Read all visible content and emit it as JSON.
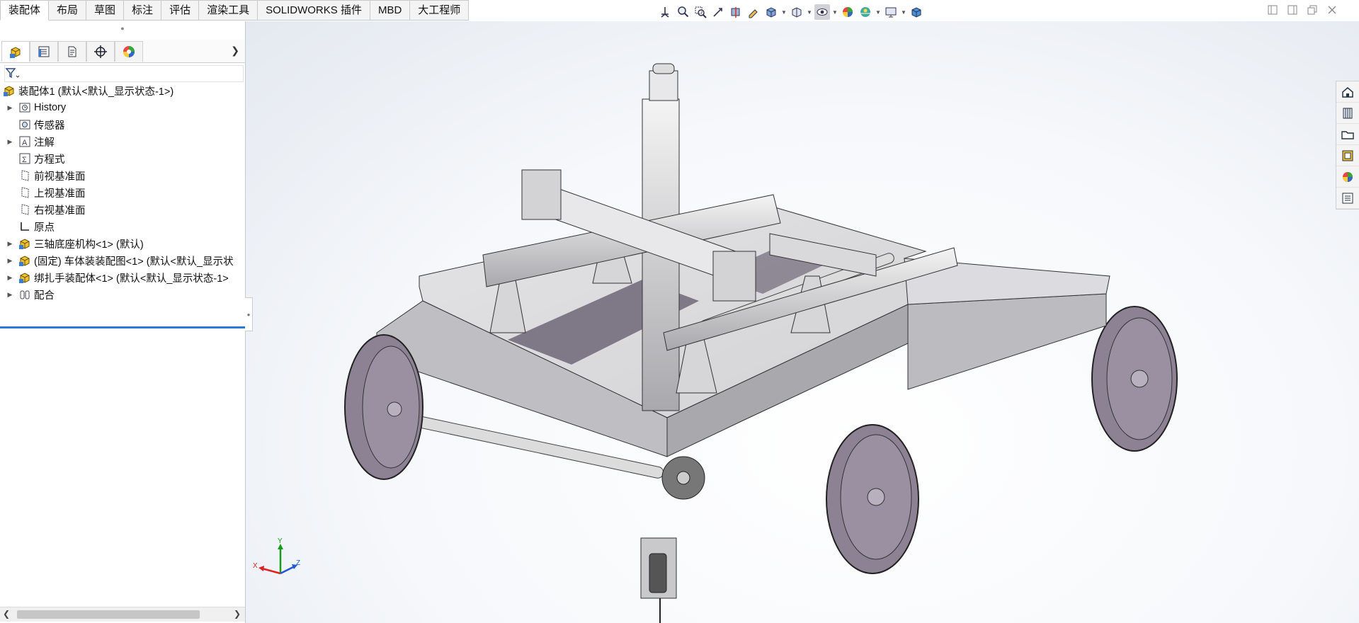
{
  "ribbon": {
    "tabs": [
      {
        "label": "装配体",
        "active": true
      },
      {
        "label": "布局"
      },
      {
        "label": "草图"
      },
      {
        "label": "标注"
      },
      {
        "label": "评估"
      },
      {
        "label": "渲染工具"
      },
      {
        "label": "SOLIDWORKS 插件"
      },
      {
        "label": "MBD"
      },
      {
        "label": "大工程师"
      }
    ]
  },
  "view_toolbar": {
    "icons": [
      "view-orientation-icon",
      "zoom-to-fit-icon",
      "zoom-to-area-icon",
      "previous-view-icon",
      "section-view-icon",
      "dynamic-annotation-icon",
      "view-orientation-cube-icon",
      "display-style-icon",
      "hide-show-items-icon",
      "edit-appearance-icon",
      "apply-scene-icon",
      "view-settings-icon",
      "3d-view-icon"
    ]
  },
  "feature_tree": {
    "panel_tabs": [
      "featuremanager-icon",
      "propertymanager-icon",
      "configurationmanager-icon",
      "dimxpert-icon",
      "displaymanager-icon"
    ],
    "nodes": [
      {
        "label": "装配体1  (默认<默认_显示状态-1>)",
        "icon": "assembly-icon",
        "expandable": false,
        "root": true
      },
      {
        "label": "History",
        "icon": "history-icon",
        "expandable": true
      },
      {
        "label": "传感器",
        "icon": "sensor-icon",
        "expandable": false
      },
      {
        "label": "注解",
        "icon": "annotation-icon",
        "expandable": true
      },
      {
        "label": "方程式",
        "icon": "equation-icon",
        "expandable": false
      },
      {
        "label": "前视基准面",
        "icon": "plane-icon",
        "expandable": false
      },
      {
        "label": "上视基准面",
        "icon": "plane-icon",
        "expandable": false
      },
      {
        "label": "右视基准面",
        "icon": "plane-icon",
        "expandable": false
      },
      {
        "label": "原点",
        "icon": "origin-icon",
        "expandable": false
      },
      {
        "label": "三轴底座机构<1> (默认)",
        "icon": "subassembly-icon",
        "expandable": true
      },
      {
        "label": "(固定) 车体装装配图<1> (默认<默认_显示状",
        "icon": "subassembly-icon",
        "expandable": true
      },
      {
        "label": "绑扎手装配体<1> (默认<默认_显示状态-1>",
        "icon": "subassembly-icon",
        "expandable": true
      },
      {
        "label": "配合",
        "icon": "mates-icon",
        "expandable": true
      }
    ]
  },
  "task_pane": {
    "icons": [
      "solidworks-resources-icon",
      "design-library-icon",
      "file-explorer-icon",
      "view-palette-icon",
      "appearances-icon",
      "custom-properties-icon"
    ]
  },
  "triad": {
    "x_label": "X",
    "y_label": "Y",
    "z_label": "Z"
  },
  "colors": {
    "model_face": "#c9c9cb",
    "model_shadow": "#6f6677",
    "wheel": "#8c8294",
    "accent": "#2a7ad8"
  }
}
